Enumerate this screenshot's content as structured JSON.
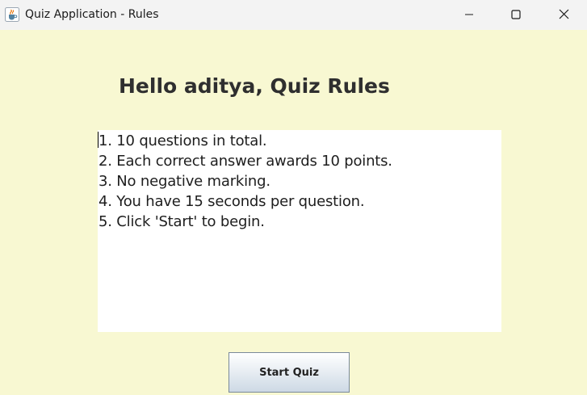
{
  "window": {
    "title": "Quiz Application - Rules",
    "controls": {
      "minimize": "minimize-icon",
      "maximize": "maximize-icon",
      "close": "close-icon"
    },
    "app_icon": "java-cup-icon"
  },
  "colors": {
    "background": "#f8f8d2",
    "titlebar": "#f3f3f3",
    "text_area": "#ffffff",
    "heading_text": "#2f2f2f"
  },
  "heading": "Hello aditya, Quiz Rules",
  "rules": [
    "1. 10 questions in total.",
    "2. Each correct answer awards 10 points.",
    "3. No negative marking.",
    "4. You have 15 seconds per question.",
    "5. Click 'Start' to begin."
  ],
  "start_button_label": "Start Quiz"
}
